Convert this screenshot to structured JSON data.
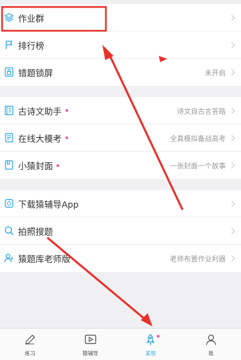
{
  "group1": [
    {
      "label": "作业群",
      "right": "",
      "icon": "layers-icon"
    },
    {
      "label": "排行榜",
      "right": "",
      "icon": "flag-icon"
    },
    {
      "label": "错题锁屏",
      "right": "未开启",
      "icon": "lock-screen-icon"
    }
  ],
  "group2": [
    {
      "label": "古诗文助手",
      "right": "诗文自古言答路",
      "icon": "book-icon"
    },
    {
      "label": "在线大模考",
      "right": "全真模拟备战高考",
      "icon": "exam-paper-icon"
    },
    {
      "label": "小猿封面",
      "right": "一张封面一个故事",
      "icon": "cover-icon"
    }
  ],
  "group3": [
    {
      "label": "下载猿辅导App",
      "right": "",
      "icon": "app-download-icon"
    },
    {
      "label": "拍照搜题",
      "right": "",
      "icon": "search-icon"
    },
    {
      "label": "猿题库老师版",
      "right": "老师布置作业利器",
      "icon": "teacher-icon"
    }
  ],
  "tabbar": {
    "tabs": [
      {
        "label": "练习",
        "icon": "pencil-icon"
      },
      {
        "label": "猿辅导",
        "icon": "video-icon"
      },
      {
        "label": "发现",
        "icon": "rocket-icon"
      },
      {
        "label": "我",
        "icon": "person-icon"
      }
    ],
    "active_color": "#2aa6e0"
  },
  "colors": {
    "accent": "#2aa6e0",
    "badge_dot": "#f05fb6",
    "annotation_red": "#e8322d"
  }
}
